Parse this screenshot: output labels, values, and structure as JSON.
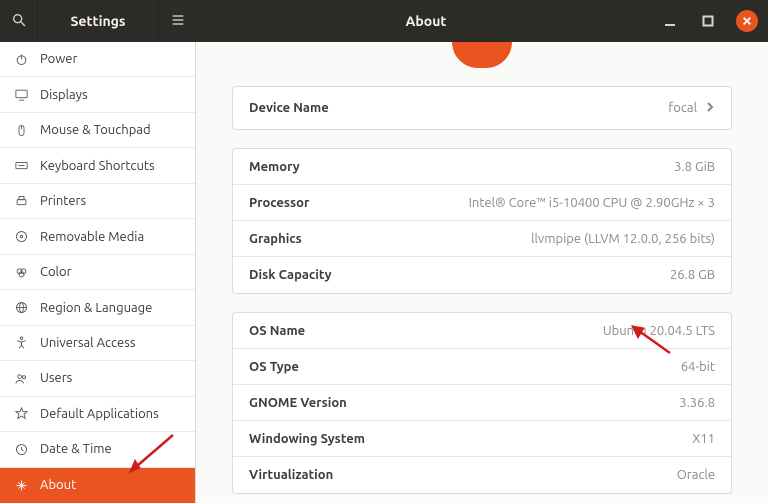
{
  "titlebar": {
    "left": "Settings",
    "right": "About"
  },
  "sidebar": {
    "items": [
      {
        "label": "Power"
      },
      {
        "label": "Displays"
      },
      {
        "label": "Mouse & Touchpad"
      },
      {
        "label": "Keyboard Shortcuts"
      },
      {
        "label": "Printers"
      },
      {
        "label": "Removable Media"
      },
      {
        "label": "Color"
      },
      {
        "label": "Region & Language"
      },
      {
        "label": "Universal Access"
      },
      {
        "label": "Users"
      },
      {
        "label": "Default Applications"
      },
      {
        "label": "Date & Time"
      },
      {
        "label": "About"
      }
    ]
  },
  "device": {
    "name_label": "Device Name",
    "name_value": "focal"
  },
  "hardware": {
    "memory_label": "Memory",
    "memory_value": "3.8 GiB",
    "processor_label": "Processor",
    "processor_value": "Intel® Core™ i5-10400 CPU @ 2.90GHz × 3",
    "graphics_label": "Graphics",
    "graphics_value": "llvmpipe (LLVM 12.0.0, 256 bits)",
    "disk_label": "Disk Capacity",
    "disk_value": "26.8 GB"
  },
  "os": {
    "name_label": "OS Name",
    "name_value": "Ubuntu 20.04.5 LTS",
    "type_label": "OS Type",
    "type_value": "64-bit",
    "gnome_label": "GNOME Version",
    "gnome_value": "3.36.8",
    "ws_label": "Windowing System",
    "ws_value": "X11",
    "virt_label": "Virtualization",
    "virt_value": "Oracle"
  }
}
